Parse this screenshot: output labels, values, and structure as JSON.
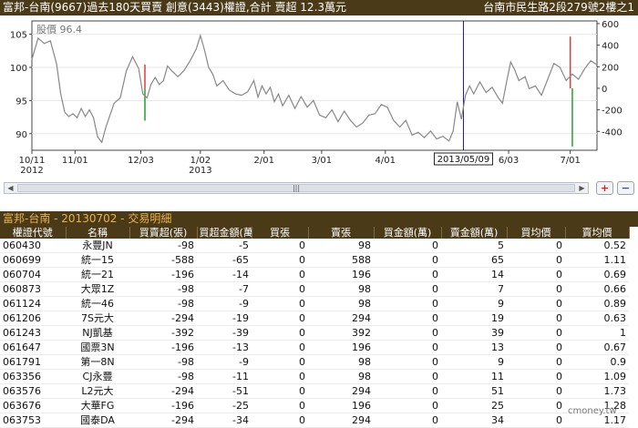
{
  "header": {
    "title_left": "富邦-台南(9667)過去180天買賣 創意(3443)權證,合計 賣超 12.3萬元",
    "title_right": "台南市民生路2段279號2樓之1"
  },
  "chart_data": {
    "type": "line",
    "price_label": "股價 96.4",
    "x_ticks": [
      {
        "d": 0,
        "label": "10/11",
        "label2": "2012"
      },
      {
        "d": 21,
        "label": "11/01"
      },
      {
        "d": 53,
        "label": "12/03"
      },
      {
        "d": 82,
        "label": "1/02",
        "label2": "2013"
      },
      {
        "d": 113,
        "label": "2/01"
      },
      {
        "d": 141,
        "label": "3/01"
      },
      {
        "d": 172,
        "label": "4/01"
      },
      {
        "d": 232,
        "label": "6/03"
      },
      {
        "d": 262,
        "label": "7/01"
      }
    ],
    "marker_label": "2013/05/09",
    "marker_d": 210,
    "y_left_ticks": [
      90,
      95,
      100,
      105
    ],
    "y_left_range": [
      87.5,
      107
    ],
    "y_right_ticks": [
      -400,
      -200,
      0,
      200,
      400,
      600
    ],
    "y_right_range": [
      -575,
      625
    ],
    "x_range": [
      0,
      275
    ],
    "price_points": [
      [
        0,
        101.2
      ],
      [
        3,
        104.4
      ],
      [
        6,
        103.6
      ],
      [
        9,
        104.0
      ],
      [
        12,
        100.5
      ],
      [
        14,
        96.0
      ],
      [
        16,
        93.2
      ],
      [
        18,
        92.6
      ],
      [
        20,
        93.0
      ],
      [
        22,
        92.4
      ],
      [
        24,
        93.8
      ],
      [
        26,
        92.6
      ],
      [
        28,
        93.6
      ],
      [
        30,
        92.4
      ],
      [
        32,
        89.5
      ],
      [
        34,
        88.7
      ],
      [
        36,
        91.0
      ],
      [
        38,
        92.8
      ],
      [
        40,
        94.6
      ],
      [
        43,
        95.4
      ],
      [
        46,
        99.5
      ],
      [
        49,
        101.6
      ],
      [
        52,
        99.8
      ],
      [
        54,
        96.0
      ],
      [
        56,
        95.4
      ],
      [
        58,
        97.5
      ],
      [
        60,
        98.5
      ],
      [
        62,
        97.4
      ],
      [
        64,
        98.0
      ],
      [
        66,
        100.2
      ],
      [
        68,
        99.5
      ],
      [
        71,
        98.6
      ],
      [
        74,
        99.5
      ],
      [
        77,
        101.0
      ],
      [
        80,
        102.8
      ],
      [
        82,
        104.8
      ],
      [
        84,
        102.6
      ],
      [
        86,
        100.0
      ],
      [
        88,
        99.0
      ],
      [
        90,
        97.2
      ],
      [
        93,
        98.0
      ],
      [
        96,
        96.6
      ],
      [
        99,
        96.0
      ],
      [
        102,
        95.8
      ],
      [
        105,
        96.3
      ],
      [
        108,
        98.0
      ],
      [
        110,
        95.5
      ],
      [
        112,
        97.2
      ],
      [
        114,
        96.0
      ],
      [
        116,
        97.0
      ],
      [
        118,
        94.8
      ],
      [
        120,
        96.0
      ],
      [
        122,
        94.2
      ],
      [
        125,
        95.8
      ],
      [
        128,
        93.8
      ],
      [
        131,
        95.6
      ],
      [
        134,
        94.0
      ],
      [
        137,
        95.0
      ],
      [
        140,
        92.8
      ],
      [
        143,
        92.4
      ],
      [
        146,
        93.6
      ],
      [
        149,
        91.8
      ],
      [
        152,
        93.4
      ],
      [
        155,
        92.0
      ],
      [
        158,
        91.0
      ],
      [
        161,
        91.6
      ],
      [
        164,
        92.8
      ],
      [
        167,
        93.0
      ],
      [
        170,
        94.4
      ],
      [
        173,
        94.0
      ],
      [
        176,
        92.0
      ],
      [
        179,
        91.0
      ],
      [
        182,
        92.0
      ],
      [
        185,
        89.8
      ],
      [
        188,
        90.2
      ],
      [
        191,
        89.4
      ],
      [
        194,
        90.4
      ],
      [
        197,
        89.2
      ],
      [
        200,
        89.6
      ],
      [
        203,
        88.9
      ],
      [
        205,
        90.4
      ],
      [
        207,
        94.8
      ],
      [
        209,
        92.2
      ],
      [
        211,
        95.8
      ],
      [
        213,
        97.2
      ],
      [
        215,
        96.0
      ],
      [
        218,
        97.8
      ],
      [
        221,
        96.2
      ],
      [
        224,
        97.0
      ],
      [
        227,
        95.4
      ],
      [
        229,
        94.6
      ],
      [
        231,
        97.8
      ],
      [
        233,
        100.8
      ],
      [
        235,
        99.6
      ],
      [
        237,
        98.0
      ],
      [
        240,
        98.6
      ],
      [
        242,
        96.8
      ],
      [
        245,
        97.2
      ],
      [
        248,
        95.8
      ],
      [
        251,
        98.2
      ],
      [
        254,
        100.6
      ],
      [
        257,
        100.0
      ],
      [
        260,
        98.0
      ],
      [
        263,
        99.0
      ],
      [
        266,
        98.2
      ],
      [
        269,
        99.8
      ],
      [
        272,
        101.0
      ],
      [
        275,
        100.4
      ]
    ],
    "volume_bars": [
      {
        "d": 55,
        "v": 220,
        "c": "#e23c3c"
      },
      {
        "d": 55,
        "v": -300,
        "c": "#22a030"
      },
      {
        "d": 262,
        "v": 480,
        "c": "#e23c3c"
      },
      {
        "d": 263,
        "v": -540,
        "c": "#22a030"
      }
    ]
  },
  "scrollbar": {
    "left_arrow": "◀",
    "thumb_grip": "|||",
    "right_arrow": "▶"
  },
  "zoom": {
    "in": "+",
    "out": "−"
  },
  "subheader": {
    "title": "富邦-台南 - 20130702 - 交易明細"
  },
  "table": {
    "columns": [
      "權證代號",
      "名稱",
      "買賣超(張)",
      "買超金額(萬)",
      "買張",
      "賣張",
      "買金額(萬)",
      "賣金額(萬)",
      "買均價",
      "賣均價"
    ],
    "rows": [
      [
        "060430",
        "永豐JN",
        "-98",
        "-5",
        "0",
        "98",
        "0",
        "5",
        "0",
        "0.52"
      ],
      [
        "060699",
        "統一15",
        "-588",
        "-65",
        "0",
        "588",
        "0",
        "65",
        "0",
        "1.11"
      ],
      [
        "060704",
        "統一21",
        "-196",
        "-14",
        "0",
        "196",
        "0",
        "14",
        "0",
        "0.69"
      ],
      [
        "060873",
        "大眾1Z",
        "-98",
        "-7",
        "0",
        "98",
        "0",
        "7",
        "0",
        "0.66"
      ],
      [
        "061124",
        "統一46",
        "-98",
        "-9",
        "0",
        "98",
        "0",
        "9",
        "0",
        "0.89"
      ],
      [
        "061206",
        "7S元大",
        "-294",
        "-19",
        "0",
        "294",
        "0",
        "19",
        "0",
        "0.63"
      ],
      [
        "061243",
        "NJ凱基",
        "-392",
        "-39",
        "0",
        "392",
        "0",
        "39",
        "0",
        "1"
      ],
      [
        "061647",
        "國票3N",
        "-196",
        "-13",
        "0",
        "196",
        "0",
        "13",
        "0",
        "0.67"
      ],
      [
        "061791",
        "第一8N",
        "-98",
        "-9",
        "0",
        "98",
        "0",
        "9",
        "0",
        "0.9"
      ],
      [
        "063356",
        "CJ永豐",
        "-98",
        "-11",
        "0",
        "98",
        "0",
        "11",
        "0",
        "1.09"
      ],
      [
        "063576",
        "L2元大",
        "-294",
        "-51",
        "0",
        "294",
        "0",
        "51",
        "0",
        "1.73"
      ],
      [
        "063676",
        "大華FG",
        "-196",
        "-25",
        "0",
        "196",
        "0",
        "25",
        "0",
        "1.28"
      ],
      [
        "063753",
        "國泰DA",
        "-294",
        "-34",
        "0",
        "294",
        "0",
        "34",
        "0",
        "1.17"
      ]
    ]
  },
  "watermark": "cmoney.tw",
  "colors": {
    "header_bg": "#4a3a18",
    "sub_title": "#e8b24c",
    "price_line": "#888888",
    "marker_line": "#1b1b7a",
    "buy": "#e23c3c",
    "sell": "#22a030"
  }
}
